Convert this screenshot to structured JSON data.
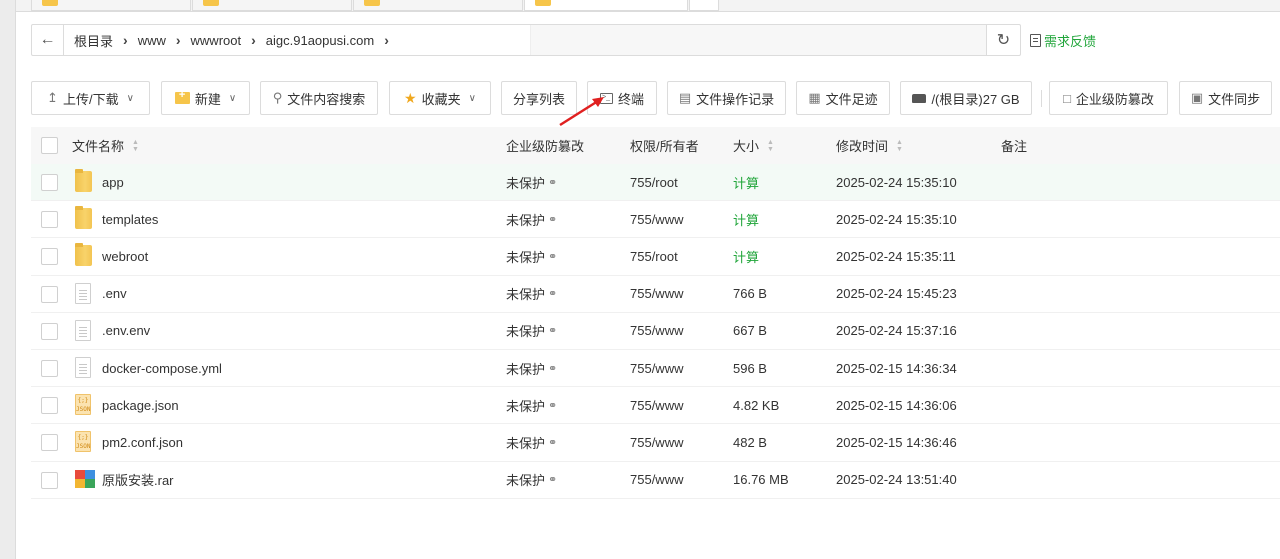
{
  "breadcrumb": {
    "items": [
      "根目录",
      "www",
      "wwwroot",
      "aigc.91aopusi.com"
    ]
  },
  "feedback_label": "需求反馈",
  "toolbar": {
    "upload_download": "上传/下载",
    "new": "新建",
    "content_search": "文件内容搜索",
    "favorites": "收藏夹",
    "share_list": "分享列表",
    "terminal": "终端",
    "operation_log": "文件操作记录",
    "file_footprint": "文件足迹",
    "disk": "/(根目录)27 GB",
    "tamper_protect": "企业级防篡改",
    "file_sync": "文件同步"
  },
  "table": {
    "headers": {
      "name": "文件名称",
      "protect": "企业级防篡改",
      "perm": "权限/所有者",
      "size": "大小",
      "mtime": "修改时间",
      "note": "备注"
    },
    "rows": [
      {
        "type": "folder",
        "name": "app",
        "protect": "未保护",
        "perm": "755/root",
        "size": "计算",
        "mtime": "2025-02-24 15:35:10"
      },
      {
        "type": "folder",
        "name": "templates",
        "protect": "未保护",
        "perm": "755/www",
        "size": "计算",
        "mtime": "2025-02-24 15:35:10"
      },
      {
        "type": "folder",
        "name": "webroot",
        "protect": "未保护",
        "perm": "755/root",
        "size": "计算",
        "mtime": "2025-02-24 15:35:11"
      },
      {
        "type": "file",
        "name": ".env",
        "protect": "未保护",
        "perm": "755/www",
        "size": "766 B",
        "mtime": "2025-02-24 15:45:23"
      },
      {
        "type": "file",
        "name": ".env.env",
        "protect": "未保护",
        "perm": "755/www",
        "size": "667 B",
        "mtime": "2025-02-24 15:37:16"
      },
      {
        "type": "file",
        "name": "docker-compose.yml",
        "protect": "未保护",
        "perm": "755/www",
        "size": "596 B",
        "mtime": "2025-02-15 14:36:34"
      },
      {
        "type": "json",
        "name": "package.json",
        "protect": "未保护",
        "perm": "755/www",
        "size": "4.82 KB",
        "mtime": "2025-02-15 14:36:06"
      },
      {
        "type": "json",
        "name": "pm2.conf.json",
        "protect": "未保护",
        "perm": "755/www",
        "size": "482 B",
        "mtime": "2025-02-15 14:36:46"
      },
      {
        "type": "rar",
        "name": "原版安装.rar",
        "protect": "未保护",
        "perm": "755/www",
        "size": "16.76 MB",
        "mtime": "2025-02-24 13:51:40"
      }
    ]
  },
  "colors": {
    "accent_green": "#20a53a",
    "folder_yellow": "#f6c54a",
    "arrow_red": "#e02020"
  }
}
